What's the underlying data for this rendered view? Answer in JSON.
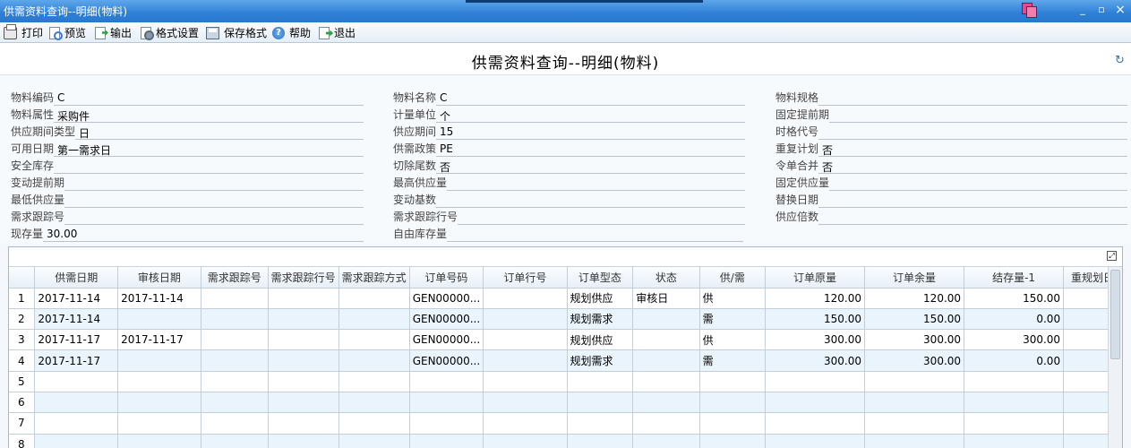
{
  "window": {
    "title": "供需资料查询--明细(物料)",
    "minimize": "_",
    "restore": "▫",
    "close": "×"
  },
  "toolbar": {
    "print": "打印",
    "preview": "预览",
    "export": "输出",
    "format_settings": "格式设置",
    "save_format": "保存格式",
    "help": "帮助",
    "exit": "退出"
  },
  "page_title": "供需资料查询--明细(物料)",
  "form": {
    "col1": [
      {
        "label": "物料编码",
        "value": "C"
      },
      {
        "label": "物料属性",
        "value": "采购件"
      },
      {
        "label": "供应期间类型",
        "value": "日"
      },
      {
        "label": "可用日期",
        "value": "第一需求日"
      },
      {
        "label": "安全库存",
        "value": ""
      },
      {
        "label": "变动提前期",
        "value": ""
      },
      {
        "label": "最低供应量",
        "value": ""
      },
      {
        "label": "需求跟踪号",
        "value": ""
      },
      {
        "label": "现存量",
        "value": "30.00"
      }
    ],
    "col2": [
      {
        "label": "物料名称",
        "value": "C"
      },
      {
        "label": "计量单位",
        "value": "个"
      },
      {
        "label": "供应期间",
        "value": "15"
      },
      {
        "label": "供需政策",
        "value": "PE"
      },
      {
        "label": "切除尾数",
        "value": "否"
      },
      {
        "label": "最高供应量",
        "value": ""
      },
      {
        "label": "变动基数",
        "value": ""
      },
      {
        "label": "需求跟踪行号",
        "value": ""
      },
      {
        "label": "自由库存量",
        "value": ""
      }
    ],
    "col3": [
      {
        "label": "物料规格",
        "value": ""
      },
      {
        "label": "固定提前期",
        "value": ""
      },
      {
        "label": "时格代号",
        "value": ""
      },
      {
        "label": "重复计划",
        "value": "否"
      },
      {
        "label": "令单合并",
        "value": "否"
      },
      {
        "label": "固定供应量",
        "value": ""
      },
      {
        "label": "替换日期",
        "value": ""
      },
      {
        "label": "供应倍数",
        "value": ""
      }
    ]
  },
  "grid": {
    "columns": [
      "",
      "供需日期",
      "审核日期",
      "需求跟踪号",
      "需求跟踪行号",
      "需求跟踪方式",
      "订单号码",
      "订单行号",
      "订单型态",
      "状态",
      "供/需",
      "订单原量",
      "订单余量",
      "结存量-1",
      "重规划日"
    ],
    "rows": [
      [
        "1",
        "2017-11-14",
        "2017-11-14",
        "",
        "",
        "",
        "GEN00000...",
        "",
        "规划供应",
        "审核日",
        "供",
        "120.00",
        "120.00",
        "150.00",
        ""
      ],
      [
        "2",
        "2017-11-14",
        "",
        "",
        "",
        "",
        "GEN00000...",
        "",
        "规划需求",
        "",
        "需",
        "150.00",
        "150.00",
        "0.00",
        ""
      ],
      [
        "3",
        "2017-11-17",
        "2017-11-17",
        "",
        "",
        "",
        "GEN00000...",
        "",
        "规划供应",
        "",
        "供",
        "300.00",
        "300.00",
        "300.00",
        ""
      ],
      [
        "4",
        "2017-11-17",
        "",
        "",
        "",
        "",
        "GEN00000...",
        "",
        "规划需求",
        "",
        "需",
        "300.00",
        "300.00",
        "0.00",
        ""
      ],
      [
        "5",
        "",
        "",
        "",
        "",
        "",
        "",
        "",
        "",
        "",
        "",
        "",
        "",
        "",
        ""
      ],
      [
        "6",
        "",
        "",
        "",
        "",
        "",
        "",
        "",
        "",
        "",
        "",
        "",
        "",
        "",
        ""
      ],
      [
        "7",
        "",
        "",
        "",
        "",
        "",
        "",
        "",
        "",
        "",
        "",
        "",
        "",
        "",
        ""
      ],
      [
        "8",
        "",
        "",
        "",
        "",
        "",
        "",
        "",
        "",
        "",
        "",
        "",
        "",
        "",
        ""
      ]
    ]
  },
  "colors": {
    "titlebar": "#2d7fd6",
    "row_alt": "#e9f4fd",
    "accent": "#2a78cc"
  }
}
